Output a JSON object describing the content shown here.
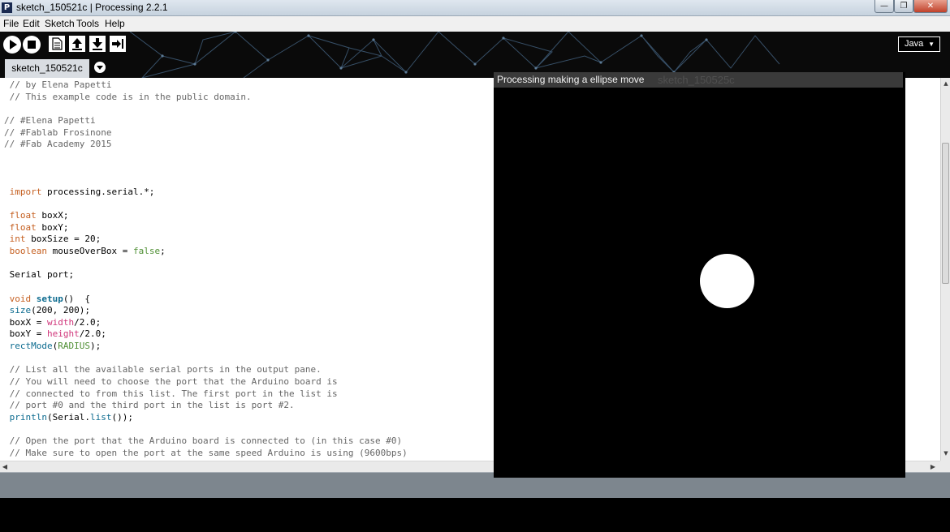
{
  "window": {
    "app_icon": "P",
    "title": "sketch_150521c | Processing 2.2.1",
    "controls": {
      "minimize": "—",
      "maximize": "❐",
      "close": "✕"
    }
  },
  "menu": [
    "File",
    "Edit",
    "Sketch",
    "Tools",
    "Help"
  ],
  "toolbar": {
    "buttons": [
      "run-icon",
      "stop-icon",
      "new-icon",
      "open-icon",
      "save-icon",
      "export-icon"
    ],
    "mode": "Java"
  },
  "tabs": {
    "active": "sketch_150521c"
  },
  "code": [
    [
      {
        "t": "c",
        "v": " // by Elena Papetti"
      }
    ],
    [
      {
        "t": "c",
        "v": " // This example code is in the public domain."
      }
    ],
    [
      {
        "t": "",
        "v": ""
      }
    ],
    [
      {
        "t": "c",
        "v": "// #Elena Papetti"
      }
    ],
    [
      {
        "t": "c",
        "v": "// #Fablab Frosinone"
      }
    ],
    [
      {
        "t": "c",
        "v": "// #Fab Academy 2015"
      }
    ],
    [
      {
        "t": "",
        "v": ""
      }
    ],
    [
      {
        "t": "",
        "v": ""
      }
    ],
    [
      {
        "t": "",
        "v": ""
      }
    ],
    [
      {
        "t": "k",
        "v": " import"
      },
      {
        "t": "",
        "v": " processing.serial.*;"
      }
    ],
    [
      {
        "t": "",
        "v": ""
      }
    ],
    [
      {
        "t": "k",
        "v": " float"
      },
      {
        "t": "",
        "v": " boxX;"
      }
    ],
    [
      {
        "t": "k",
        "v": " float"
      },
      {
        "t": "",
        "v": " boxY;"
      }
    ],
    [
      {
        "t": "k",
        "v": " int"
      },
      {
        "t": "",
        "v": " boxSize = 20;"
      }
    ],
    [
      {
        "t": "k",
        "v": " boolean"
      },
      {
        "t": "",
        "v": " mouseOverBox = "
      },
      {
        "t": "g",
        "v": "false"
      },
      {
        "t": "",
        "v": ";"
      }
    ],
    [
      {
        "t": "",
        "v": ""
      }
    ],
    [
      {
        "t": "",
        "v": " Serial port;"
      }
    ],
    [
      {
        "t": "",
        "v": ""
      }
    ],
    [
      {
        "t": "k",
        "v": " void"
      },
      {
        "t": "",
        "v": " "
      },
      {
        "t": "fb",
        "v": "setup"
      },
      {
        "t": "",
        "v": "()  {"
      }
    ],
    [
      {
        "t": "f",
        "v": " size"
      },
      {
        "t": "",
        "v": "(200, 200);"
      }
    ],
    [
      {
        "t": "",
        "v": " boxX = "
      },
      {
        "t": "lit",
        "v": "width"
      },
      {
        "t": "",
        "v": "/2.0;"
      }
    ],
    [
      {
        "t": "",
        "v": " boxY = "
      },
      {
        "t": "lit",
        "v": "height"
      },
      {
        "t": "",
        "v": "/2.0;"
      }
    ],
    [
      {
        "t": "f",
        "v": " rectMode"
      },
      {
        "t": "",
        "v": "("
      },
      {
        "t": "g",
        "v": "RADIUS"
      },
      {
        "t": "",
        "v": ");"
      }
    ],
    [
      {
        "t": "",
        "v": ""
      }
    ],
    [
      {
        "t": "c",
        "v": " // List all the available serial ports in the output pane."
      }
    ],
    [
      {
        "t": "c",
        "v": " // You will need to choose the port that the Arduino board is"
      }
    ],
    [
      {
        "t": "c",
        "v": " // connected to from this list. The first port in the list is"
      }
    ],
    [
      {
        "t": "c",
        "v": " // port #0 and the third port in the list is port #2."
      }
    ],
    [
      {
        "t": "f",
        "v": " println"
      },
      {
        "t": "",
        "v": "(Serial."
      },
      {
        "t": "f",
        "v": "list"
      },
      {
        "t": "",
        "v": "());"
      }
    ],
    [
      {
        "t": "",
        "v": ""
      }
    ],
    [
      {
        "t": "c",
        "v": " // Open the port that the Arduino board is connected to (in this case #0)"
      }
    ],
    [
      {
        "t": "c",
        "v": " // Make sure to open the port at the same speed Arduino is using (9600bps)"
      }
    ]
  ],
  "scrollbars": {
    "up": "▲",
    "down": "▼",
    "left": "◀",
    "right": "▶"
  },
  "sketch_window": {
    "title": "Processing making a ellipse move",
    "ghost_title": "sketch_150525c"
  },
  "colors": {
    "keyword": "#c55f20",
    "function": "#0c6b8f",
    "comment": "#666666",
    "literal": "#d0357a",
    "constant": "#4f8f34"
  }
}
